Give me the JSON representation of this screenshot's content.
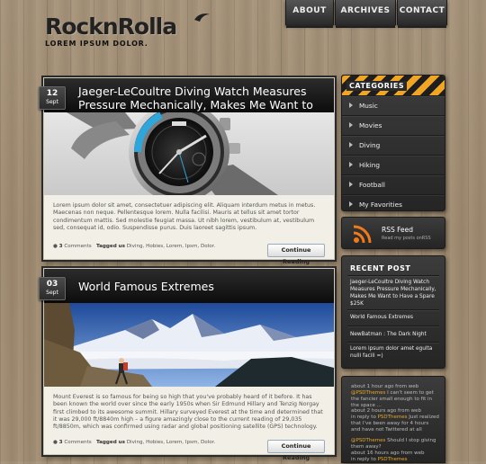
{
  "logo": {
    "text": "RocknRolla",
    "tagline": "LOREM IPSUM DOLOR."
  },
  "nav": {
    "about": "ABOUT",
    "archives": "ARCHIVES",
    "contact": "CONTACT"
  },
  "posts": [
    {
      "day": "12",
      "month": "Sept",
      "title": "Jaeger-LeCoultre Diving Watch Measures Pressure Mechanically, Makes Me Want to Have a Spare",
      "excerpt": "Lorem ipsum dolor sit amet, consectetuer adipiscing elit. Aliquam interdum metus in metus. Maecenas non neque. Pellentesque lorem. Nulla facilisi. Mauris at tellus sit amet tortor condimentum mattis. Sed molestie feugiat massa. Ut nibh lorem, vestibulum at, vestibulum sed, consequat id, odio. Suspendisse purus. Duis laoreet sagittis ipsum.",
      "comments_count": "3",
      "comments_label": "Comments",
      "tagged_label": "Tagged us",
      "tags": "Diving, Hobies, Lorem, Ipsm, Dolor.",
      "read_label": "Continue Reading"
    },
    {
      "day": "03",
      "month": "Sept",
      "title": "World Famous Extremes",
      "excerpt": "Mount Everest is so famous for being so high that you've probably heard of it before. It has been known the world over since the early 1950s when Sir Edmund Hillary and Tenzig Norgay first climbed to its awesome summit. Hillary surveyed Everest at the time and determined that it was 29,000 ft/8840m high – a figure amazingly close to the current reading of 29,035 ft/8850m, which was confirmed using radar and global positioning satellite (GPS) technology.",
      "comments_count": "3",
      "comments_label": "Comments",
      "tagged_label": "Tagged us",
      "tags": "Diving, Hobies, Lorem, Ipsm, Dolor.",
      "read_label": "Continue Reading"
    }
  ],
  "categories": {
    "title": "CATEGORIES",
    "items": [
      "Music",
      "Movies",
      "Diving",
      "Hiking",
      "Football",
      "My Favorities"
    ]
  },
  "rss": {
    "title": "RSS Feed",
    "subtitle": "Read my posts onRSS",
    "icon": "rss-icon"
  },
  "recent": {
    "title": "RECENT POST",
    "items": [
      "Jaeger-LeCoultre Diving Watch Measures Pressure Mechanically, Makes Me Want to Have a Spare $25K",
      "World Famous Extremes",
      "NewBatman : The Dark Night",
      "Lorem ipsum dolor amet egulta nulli facili =)"
    ]
  },
  "tweets": [
    {
      "time": "about 1 hour ago from web",
      "user": "@PSDThemes",
      "text": "I can't seem to get the fancier small enough to fit in the space ..."
    },
    {
      "time": "about 2 hours ago from web",
      "pre": "in reply to",
      "user": "PSDThemes",
      "text": "Just realized that I've been away for 4 hours and have not Twittered at all"
    },
    {
      "time": "",
      "user": "@PSDThemes",
      "text": "Should I stop giving them away?"
    },
    {
      "time": "about 16 hours ago from web",
      "pre": "in reply to",
      "user": "PSDThemes",
      "text": ""
    }
  ],
  "colors": {
    "accent": "#f0a623",
    "dark": "#1e1e1e",
    "wood": "#a18d73"
  }
}
